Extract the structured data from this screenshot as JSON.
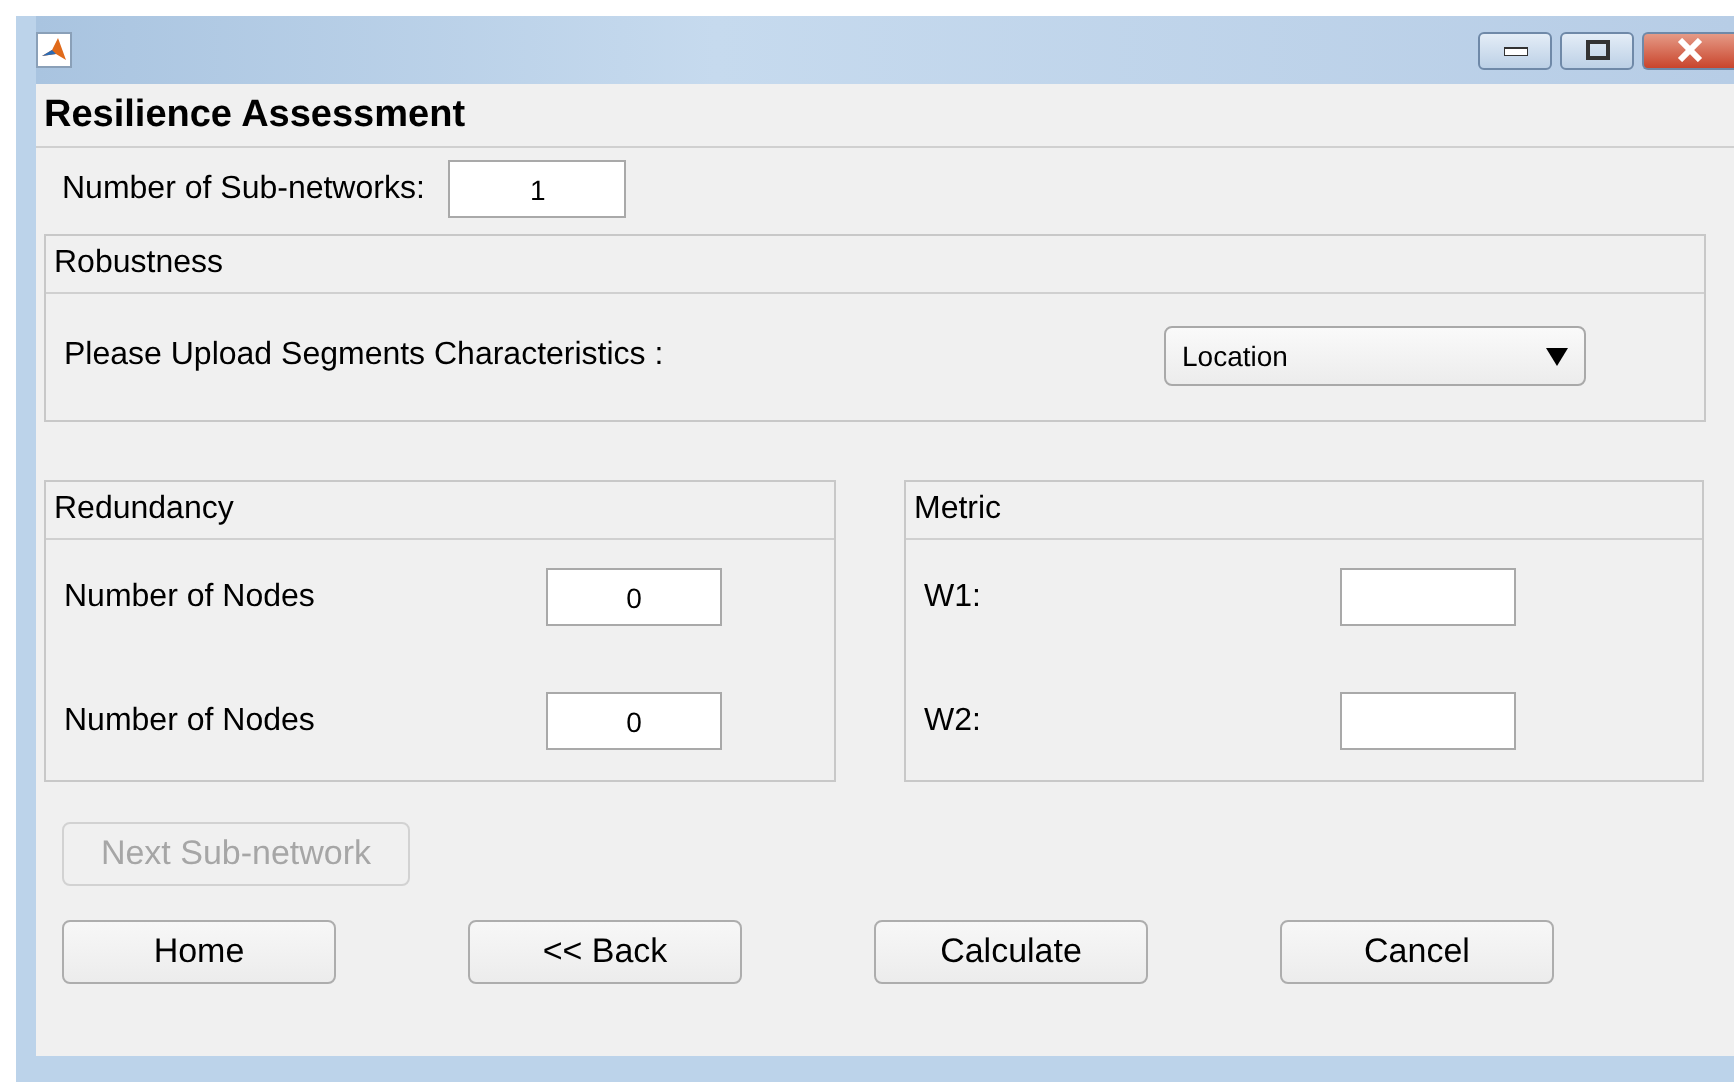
{
  "heading": "Resilience Assessment",
  "subnetworks": {
    "label": "Number of Sub-networks:",
    "value": "1"
  },
  "robustness": {
    "title": "Robustness",
    "label": "Please Upload Segments Characteristics :",
    "dropdown": "Location"
  },
  "redundancy": {
    "title": "Redundancy",
    "fields": [
      {
        "label": "Number of Nodes",
        "value": "0"
      },
      {
        "label": "Number of Nodes",
        "value": "0"
      }
    ]
  },
  "metric": {
    "title": "Metric",
    "fields": [
      {
        "label": "W1:"
      },
      {
        "label": "W2:"
      }
    ]
  },
  "next_button": {
    "label": "Next Sub-network",
    "disabled": true
  },
  "buttons": [
    "Home",
    "<< Back",
    "Calculate",
    "Cancel"
  ]
}
